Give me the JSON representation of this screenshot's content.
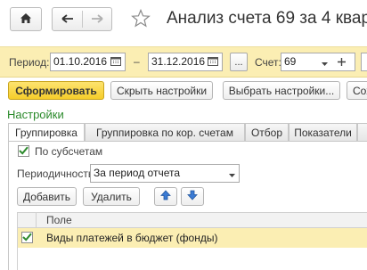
{
  "window": {
    "title": "Анализ счета 69 за 4 квар",
    "home_icon": "home-icon",
    "back_icon": "arrow-left-icon",
    "forward_icon": "arrow-right-icon",
    "favorite_icon": "star-icon"
  },
  "period_panel": {
    "period_label": "Период:",
    "date_from": "01.10.2016",
    "dash": "–",
    "date_to": "31.12.2016",
    "more_label": "...",
    "account_label": "Счет:",
    "account_value": "69"
  },
  "command_bar": {
    "generate": "Сформировать",
    "hide_settings": "Скрыть настройки",
    "choose_settings": "Выбрать настройки...",
    "save_settings": "Сох"
  },
  "settings": {
    "title": "Настройки",
    "tabs": [
      {
        "label": "Группировка",
        "active": true
      },
      {
        "label": "Группировка по кор. счетам",
        "active": false
      },
      {
        "label": "Отбор",
        "active": false
      },
      {
        "label": "Показатели",
        "active": false
      }
    ],
    "by_subaccounts_label": "По субсчетам",
    "by_subaccounts_checked": true,
    "periodicity_label": "Периодичность:",
    "periodicity_value": "За период отчета",
    "add_button": "Добавить",
    "delete_button": "Удалить",
    "grid": {
      "column_header": "Поле",
      "rows": [
        {
          "label": "Виды платежей в бюджет (фонды)",
          "checked": true
        }
      ]
    }
  },
  "colors": {
    "panel_bg": "#fbeeb3",
    "primary_button": "#f6cd2a",
    "section_title": "#2b8a2b",
    "checkmark": "#2e8b2e",
    "arrow_blue": "#3b7bd4"
  }
}
